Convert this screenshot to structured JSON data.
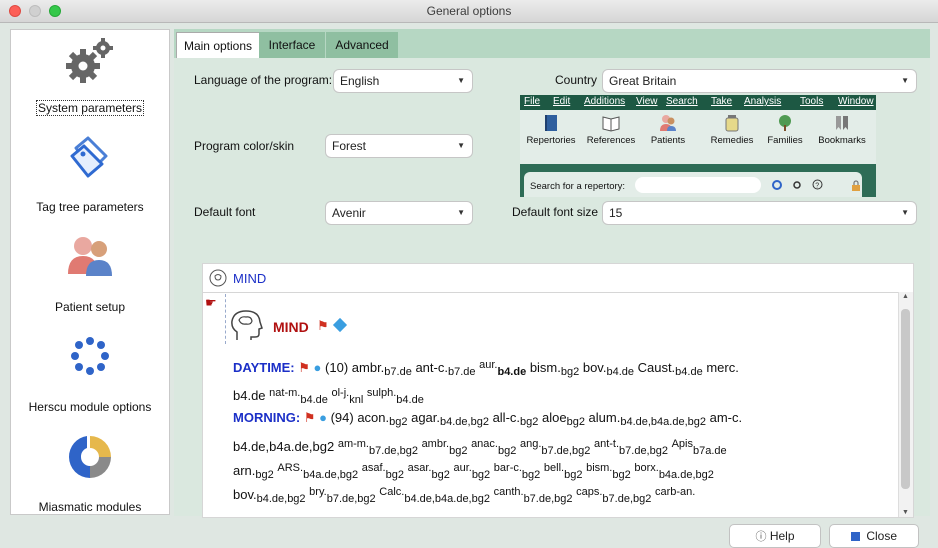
{
  "window": {
    "title": "General options"
  },
  "sidebar": {
    "items": [
      {
        "label": "System parameters",
        "icon": "gears-icon",
        "selected": true
      },
      {
        "label": "Tag tree parameters",
        "icon": "tags-icon"
      },
      {
        "label": "Patient setup",
        "icon": "patients-icon"
      },
      {
        "label": "Herscu module options",
        "icon": "dots-circle-icon"
      },
      {
        "label": "Miasmatic modules",
        "icon": "pie-ring-icon"
      }
    ]
  },
  "tabs": [
    {
      "label": "Main options",
      "active": true
    },
    {
      "label": "Interface"
    },
    {
      "label": "Advanced"
    }
  ],
  "form": {
    "language_label": "Language of the program:",
    "language_value": "English",
    "country_label": "Country",
    "country_value": "Great Britain",
    "color_label": "Program color/skin",
    "color_value": "Forest",
    "font_label": "Default font",
    "font_value": "Avenir",
    "fontsize_label": "Default font size",
    "fontsize_value": "15"
  },
  "preview": {
    "menu": [
      "File",
      "Edit",
      "Additions",
      "View",
      "Search",
      "Take",
      "Analysis",
      "Tools",
      "Window"
    ],
    "toolbar": [
      "Repertories",
      "References",
      "Patients",
      "Remedies",
      "Families",
      "Bookmarks"
    ],
    "search_label": "Search for a repertory:"
  },
  "book": {
    "header": "MIND",
    "chapter": "MIND",
    "daytime": {
      "rubric": "DAYTIME:",
      "count": "(10)"
    },
    "morning": {
      "rubric": "MORNING:",
      "count": "(94)"
    }
  },
  "buttons": {
    "help": "Help",
    "close": "Close"
  },
  "colors": {
    "panel": "#b6d7c3",
    "preview_menu": "#1d5843",
    "rubric": "#1b2fc7",
    "chapter": "#b01010"
  }
}
